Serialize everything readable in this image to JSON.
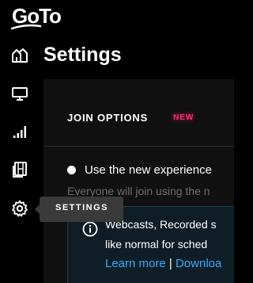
{
  "app": {
    "logo_text": "GoTo",
    "page_title": "Settings"
  },
  "sidebar": {
    "items": [
      {
        "name": "home",
        "icon": "home-icon"
      },
      {
        "name": "meetings",
        "icon": "monitor-icon"
      },
      {
        "name": "analytics",
        "icon": "signal-bars-icon"
      },
      {
        "name": "recordings",
        "icon": "film-icon"
      },
      {
        "name": "settings",
        "icon": "gear-icon"
      }
    ],
    "tooltip": "SETTINGS"
  },
  "section": {
    "title": "JOIN OPTIONS",
    "badge": "NEW"
  },
  "option": {
    "label": "Use the new experience",
    "description": "Everyone will join using the n"
  },
  "info": {
    "line1": "Webcasts, Recorded s",
    "line2": "like normal for sched",
    "learn_more": "Learn more",
    "separator": "|",
    "download": "Downloa"
  },
  "colors": {
    "background": "#000000",
    "panel": "#111111",
    "badge": "#ff2a6d",
    "link": "#3aa9ff",
    "info_box": "#0f1e26",
    "tooltip": "#3a3a3a"
  }
}
